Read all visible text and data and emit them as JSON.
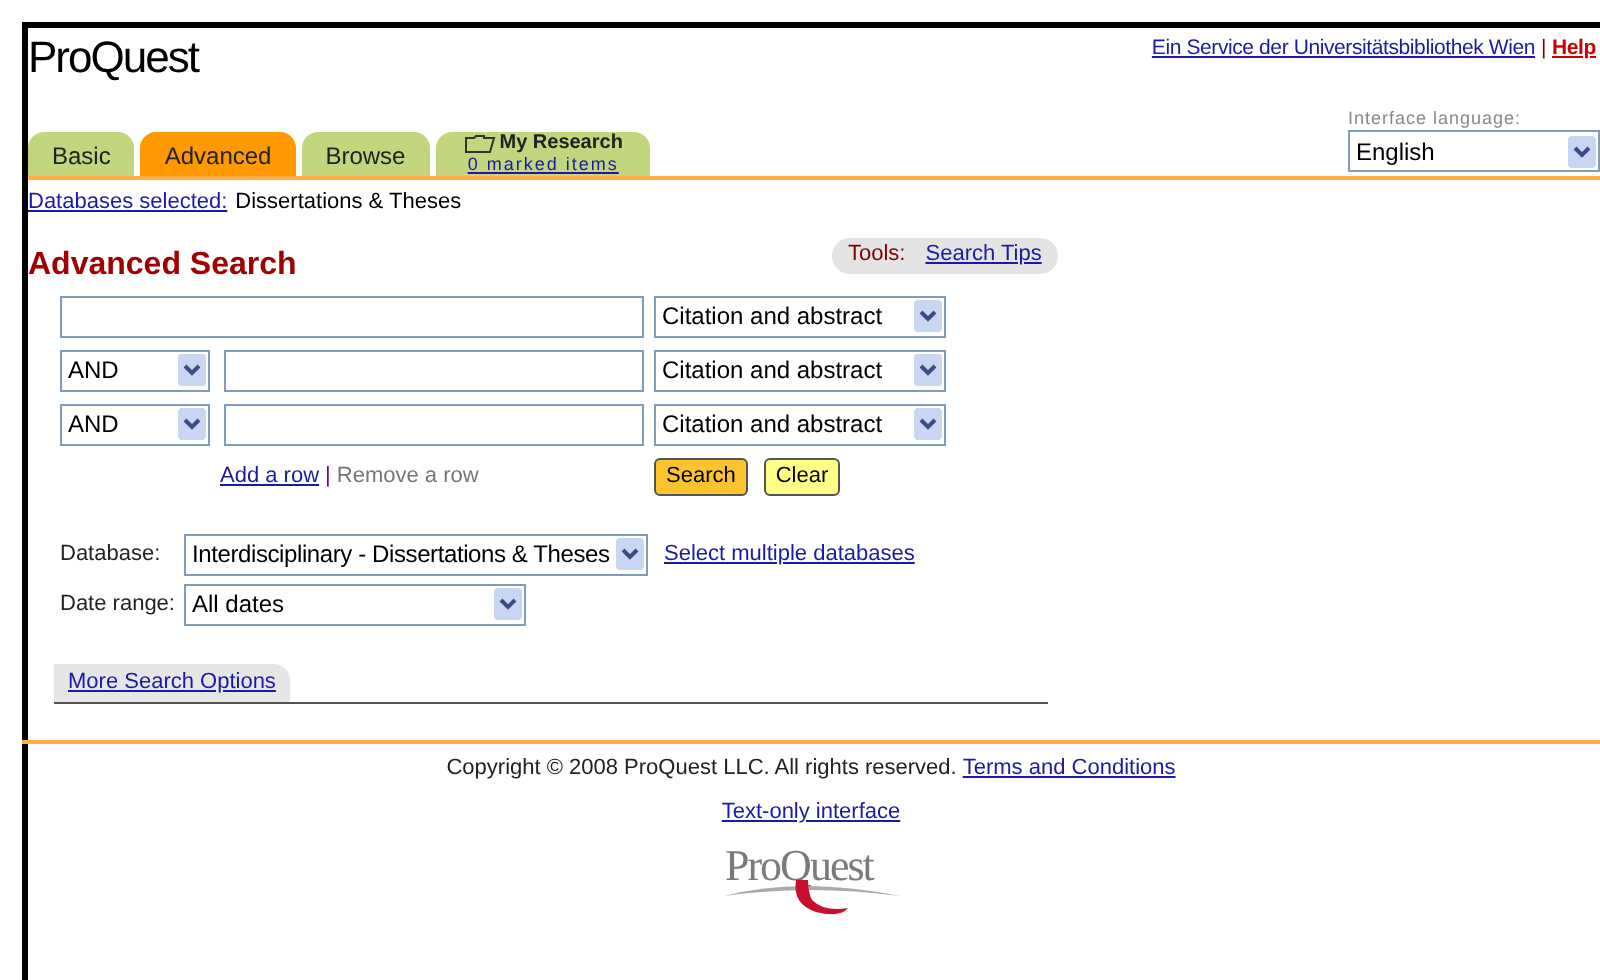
{
  "header": {
    "logo": "ProQuest",
    "service_link": "Ein Service der Universitätsbibliothek Wien",
    "separator": "|",
    "help_link": "Help",
    "language_label": "Interface language:",
    "language": "English"
  },
  "tabs": [
    {
      "label": "Basic",
      "selected": false
    },
    {
      "label": "Advanced",
      "selected": true
    },
    {
      "label": "Browse",
      "selected": false
    },
    {
      "label": "My Research",
      "sublabel": "0 marked items",
      "selected": false,
      "kind": "folder"
    }
  ],
  "databases_selected": {
    "link": "Databases selected:",
    "value": "Dissertations & Theses"
  },
  "heading": "Advanced Search",
  "tools": {
    "label": "Tools:",
    "link": "Search Tips"
  },
  "search_rows": [
    {
      "operator": null,
      "field": "Citation and abstract"
    },
    {
      "operator": "AND",
      "field": "Citation and abstract"
    },
    {
      "operator": "AND",
      "field": "Citation and abstract"
    }
  ],
  "row_actions": {
    "add": "Add a row",
    "separator": "|",
    "remove": "Remove a row"
  },
  "buttons": [
    {
      "label": "Search",
      "kind": "primary"
    },
    {
      "label": "Clear",
      "kind": "secondary"
    }
  ],
  "database": {
    "label": "Database:",
    "value": "Interdisciplinary - Dissertations & Theses",
    "link": "Select multiple databases"
  },
  "date_range": {
    "label": "Date range:",
    "value": "All dates"
  },
  "more_options_tab": "More Search Options",
  "footer": {
    "copyright": "Copyright © 2008 ProQuest LLC. All rights reserved.",
    "terms_link": "Terms and Conditions",
    "text_only_link": "Text-only interface",
    "logo": "ProQuest"
  }
}
